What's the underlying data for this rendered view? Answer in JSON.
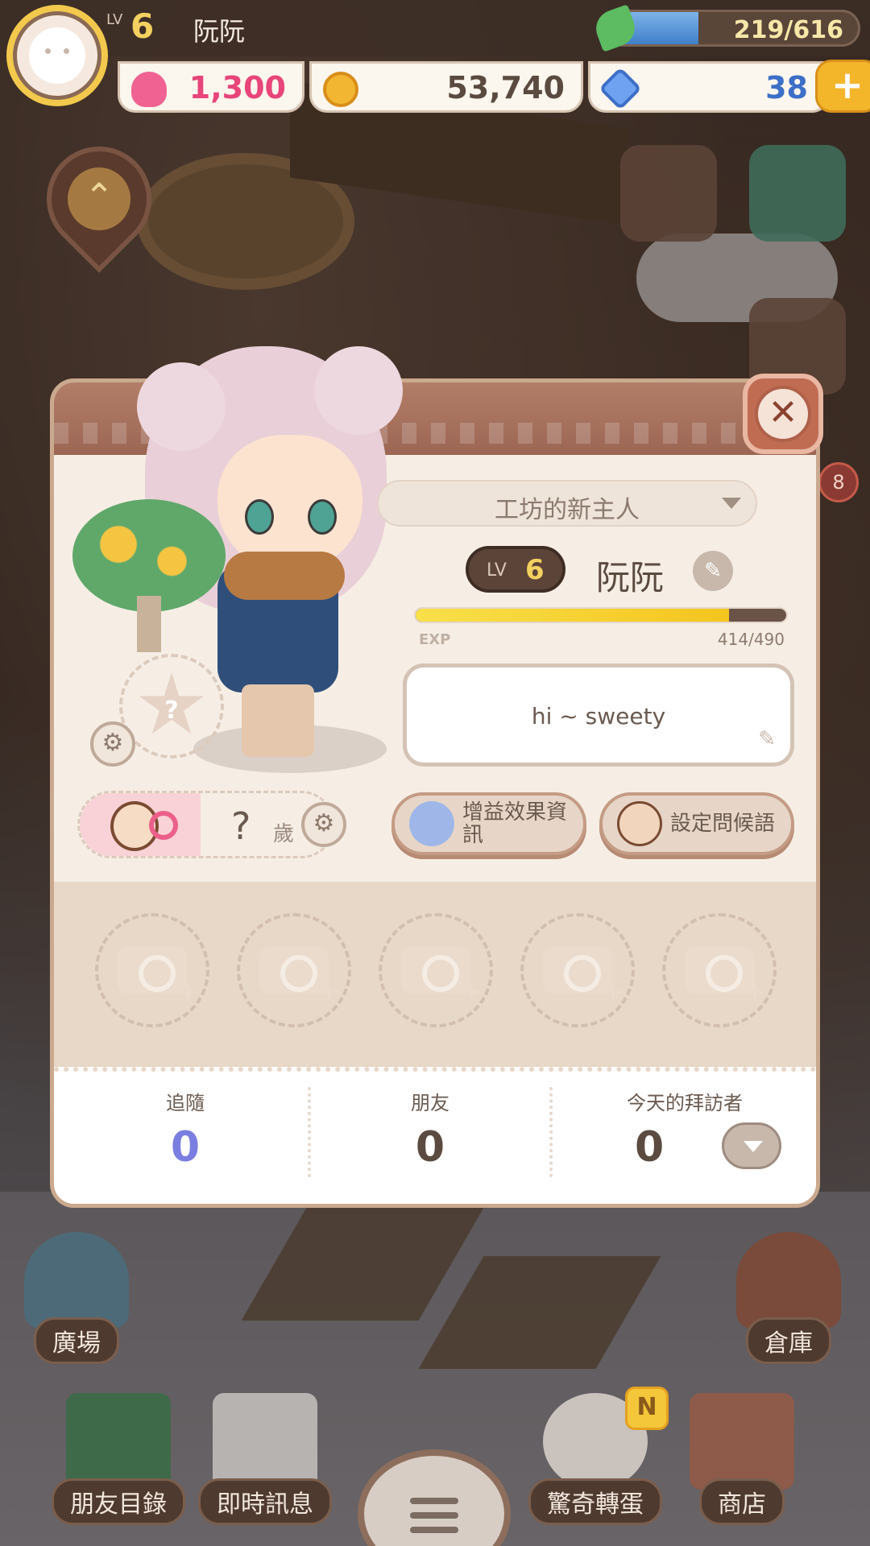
{
  "hud": {
    "level_label": "LV",
    "level": "6",
    "player_name": "阮阮",
    "energy_text": "219/616",
    "energy_fraction": 0.36,
    "hearts": "1,300",
    "coins": "53,740",
    "gems": "38",
    "add_currency_label": "+"
  },
  "side_badges": {
    "notification_count": "8",
    "new_badge": "N"
  },
  "profile": {
    "title": "工坊的新主人",
    "level_label": "LV",
    "level": "6",
    "name": "阮阮",
    "exp_label": "EXP",
    "exp_value": "414/490",
    "exp_fraction": 0.845,
    "greeting": "hi ~ sweety",
    "age": "?",
    "age_unit": "歲",
    "badge_placeholder": "?",
    "buttons": {
      "buff_info": "增益效果資訊",
      "set_greeting": "設定問候語"
    }
  },
  "photos": {
    "slots": [
      1,
      2,
      3,
      4,
      5
    ]
  },
  "stats": {
    "followers_label": "追隨",
    "followers": "0",
    "friends_label": "朋友",
    "friends": "0",
    "visitors_label": "今天的拜訪者",
    "visitors": "0"
  },
  "nav": {
    "plaza": "廣場",
    "warehouse": "倉庫",
    "friend_list": "朋友目錄",
    "instant_message": "即時訊息",
    "gacha": "驚奇轉蛋",
    "shop": "商店"
  },
  "colors": {
    "accent_gold": "#f4d060",
    "follower_blue": "#7a7ee0",
    "dialog_header": "#a8705d",
    "heart_pink": "#e8457a"
  }
}
